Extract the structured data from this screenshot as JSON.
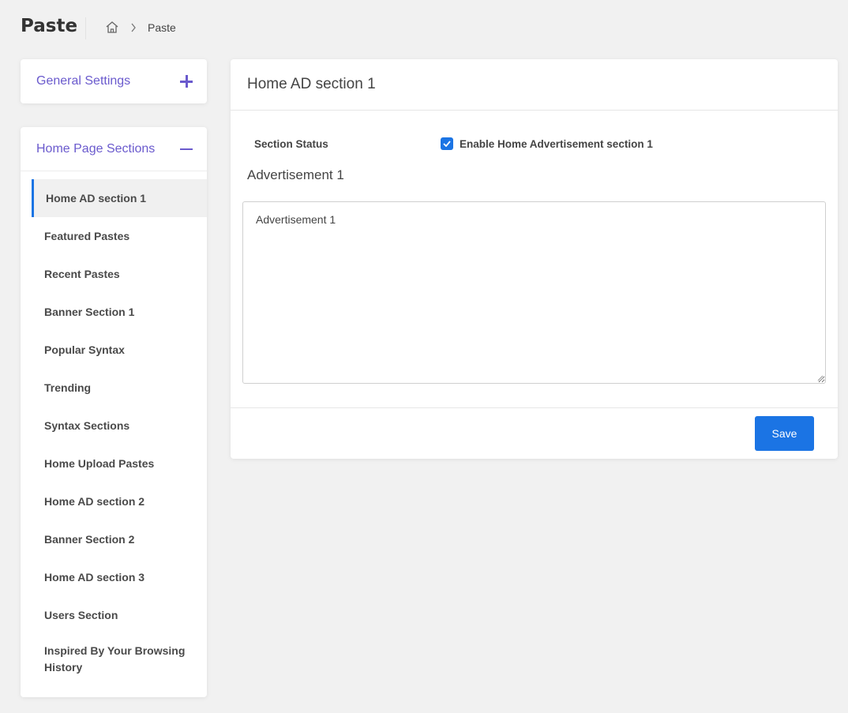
{
  "header": {
    "title": "Paste",
    "breadcrumb": {
      "current": "Paste"
    }
  },
  "sidebar": {
    "general_settings": {
      "label": "General Settings"
    },
    "home_page_sections": {
      "label": "Home Page Sections",
      "items": [
        {
          "label": "Home AD section 1",
          "active": true
        },
        {
          "label": "Featured Pastes"
        },
        {
          "label": "Recent Pastes"
        },
        {
          "label": "Banner Section 1"
        },
        {
          "label": "Popular Syntax"
        },
        {
          "label": "Trending"
        },
        {
          "label": "Syntax Sections"
        },
        {
          "label": "Home Upload Pastes"
        },
        {
          "label": "Home AD section 2"
        },
        {
          "label": "Banner Section 2"
        },
        {
          "label": "Home AD section 3"
        },
        {
          "label": "Users Section"
        },
        {
          "label": "Inspired By Your Browsing History"
        }
      ]
    }
  },
  "main": {
    "title": "Home AD section 1",
    "status_label": "Section Status",
    "checkbox_label": "Enable Home Advertisement section 1",
    "checkbox_checked": true,
    "advertisement_label": "Advertisement 1",
    "advertisement_value": "Advertisement 1",
    "save_label": "Save"
  },
  "colors": {
    "accent": "#6a5acd",
    "primary": "#1b74e4",
    "background": "#f1f1f1"
  }
}
